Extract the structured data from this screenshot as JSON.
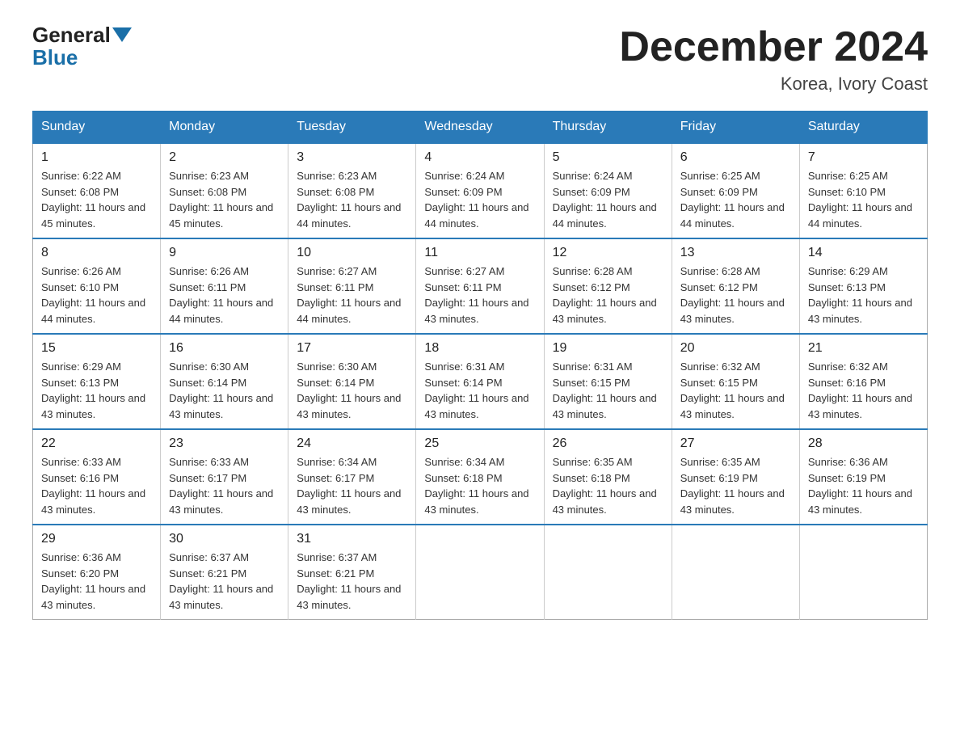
{
  "logo": {
    "general": "General",
    "blue": "Blue"
  },
  "title": "December 2024",
  "subtitle": "Korea, Ivory Coast",
  "days_of_week": [
    "Sunday",
    "Monday",
    "Tuesday",
    "Wednesday",
    "Thursday",
    "Friday",
    "Saturday"
  ],
  "weeks": [
    [
      {
        "day": "1",
        "sunrise": "6:22 AM",
        "sunset": "6:08 PM",
        "daylight": "11 hours and 45 minutes."
      },
      {
        "day": "2",
        "sunrise": "6:23 AM",
        "sunset": "6:08 PM",
        "daylight": "11 hours and 45 minutes."
      },
      {
        "day": "3",
        "sunrise": "6:23 AM",
        "sunset": "6:08 PM",
        "daylight": "11 hours and 44 minutes."
      },
      {
        "day": "4",
        "sunrise": "6:24 AM",
        "sunset": "6:09 PM",
        "daylight": "11 hours and 44 minutes."
      },
      {
        "day": "5",
        "sunrise": "6:24 AM",
        "sunset": "6:09 PM",
        "daylight": "11 hours and 44 minutes."
      },
      {
        "day": "6",
        "sunrise": "6:25 AM",
        "sunset": "6:09 PM",
        "daylight": "11 hours and 44 minutes."
      },
      {
        "day": "7",
        "sunrise": "6:25 AM",
        "sunset": "6:10 PM",
        "daylight": "11 hours and 44 minutes."
      }
    ],
    [
      {
        "day": "8",
        "sunrise": "6:26 AM",
        "sunset": "6:10 PM",
        "daylight": "11 hours and 44 minutes."
      },
      {
        "day": "9",
        "sunrise": "6:26 AM",
        "sunset": "6:11 PM",
        "daylight": "11 hours and 44 minutes."
      },
      {
        "day": "10",
        "sunrise": "6:27 AM",
        "sunset": "6:11 PM",
        "daylight": "11 hours and 44 minutes."
      },
      {
        "day": "11",
        "sunrise": "6:27 AM",
        "sunset": "6:11 PM",
        "daylight": "11 hours and 43 minutes."
      },
      {
        "day": "12",
        "sunrise": "6:28 AM",
        "sunset": "6:12 PM",
        "daylight": "11 hours and 43 minutes."
      },
      {
        "day": "13",
        "sunrise": "6:28 AM",
        "sunset": "6:12 PM",
        "daylight": "11 hours and 43 minutes."
      },
      {
        "day": "14",
        "sunrise": "6:29 AM",
        "sunset": "6:13 PM",
        "daylight": "11 hours and 43 minutes."
      }
    ],
    [
      {
        "day": "15",
        "sunrise": "6:29 AM",
        "sunset": "6:13 PM",
        "daylight": "11 hours and 43 minutes."
      },
      {
        "day": "16",
        "sunrise": "6:30 AM",
        "sunset": "6:14 PM",
        "daylight": "11 hours and 43 minutes."
      },
      {
        "day": "17",
        "sunrise": "6:30 AM",
        "sunset": "6:14 PM",
        "daylight": "11 hours and 43 minutes."
      },
      {
        "day": "18",
        "sunrise": "6:31 AM",
        "sunset": "6:14 PM",
        "daylight": "11 hours and 43 minutes."
      },
      {
        "day": "19",
        "sunrise": "6:31 AM",
        "sunset": "6:15 PM",
        "daylight": "11 hours and 43 minutes."
      },
      {
        "day": "20",
        "sunrise": "6:32 AM",
        "sunset": "6:15 PM",
        "daylight": "11 hours and 43 minutes."
      },
      {
        "day": "21",
        "sunrise": "6:32 AM",
        "sunset": "6:16 PM",
        "daylight": "11 hours and 43 minutes."
      }
    ],
    [
      {
        "day": "22",
        "sunrise": "6:33 AM",
        "sunset": "6:16 PM",
        "daylight": "11 hours and 43 minutes."
      },
      {
        "day": "23",
        "sunrise": "6:33 AM",
        "sunset": "6:17 PM",
        "daylight": "11 hours and 43 minutes."
      },
      {
        "day": "24",
        "sunrise": "6:34 AM",
        "sunset": "6:17 PM",
        "daylight": "11 hours and 43 minutes."
      },
      {
        "day": "25",
        "sunrise": "6:34 AM",
        "sunset": "6:18 PM",
        "daylight": "11 hours and 43 minutes."
      },
      {
        "day": "26",
        "sunrise": "6:35 AM",
        "sunset": "6:18 PM",
        "daylight": "11 hours and 43 minutes."
      },
      {
        "day": "27",
        "sunrise": "6:35 AM",
        "sunset": "6:19 PM",
        "daylight": "11 hours and 43 minutes."
      },
      {
        "day": "28",
        "sunrise": "6:36 AM",
        "sunset": "6:19 PM",
        "daylight": "11 hours and 43 minutes."
      }
    ],
    [
      {
        "day": "29",
        "sunrise": "6:36 AM",
        "sunset": "6:20 PM",
        "daylight": "11 hours and 43 minutes."
      },
      {
        "day": "30",
        "sunrise": "6:37 AM",
        "sunset": "6:21 PM",
        "daylight": "11 hours and 43 minutes."
      },
      {
        "day": "31",
        "sunrise": "6:37 AM",
        "sunset": "6:21 PM",
        "daylight": "11 hours and 43 minutes."
      },
      null,
      null,
      null,
      null
    ]
  ]
}
